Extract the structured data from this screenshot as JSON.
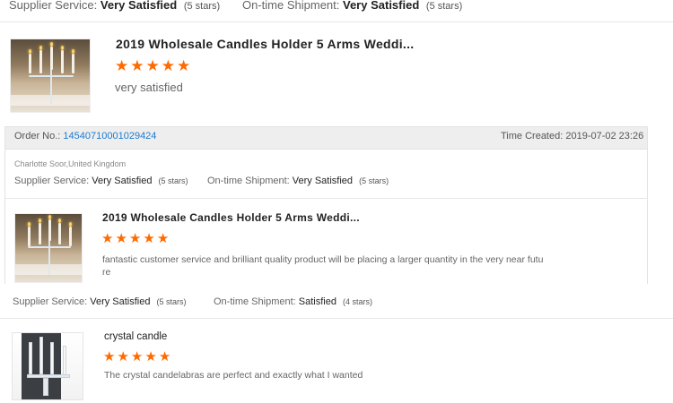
{
  "top_bar": {
    "supplier_label": "Supplier Service:",
    "supplier_value": "Very Satisfied",
    "supplier_stars": "(5 stars)",
    "shipment_label": "On-time Shipment:",
    "shipment_value": "Very Satisfied",
    "shipment_stars": "(5 stars)"
  },
  "review1": {
    "title": "2019 Wholesale Candles Holder 5 Arms Weddi...",
    "rating": 5,
    "comment": "very satisfied"
  },
  "order": {
    "label": "Order No.:",
    "number": "14540710001029424",
    "time_label": "Time Created:",
    "time_value": "2019-07-02 23:26"
  },
  "review2": {
    "buyer": "Charlotte Soor,United Kingdom",
    "supplier_label": "Supplier Service:",
    "supplier_value": "Very Satisfied",
    "supplier_stars": "(5 stars)",
    "shipment_label": "On-time Shipment:",
    "shipment_value": "Very Satisfied",
    "shipment_stars": "(5 stars)",
    "title": "2019 Wholesale Candles Holder 5 Arms Weddi...",
    "rating": 5,
    "comment_line1": "fantastic customer service and brilliant quality product will be placing a larger quantity in the very near futu",
    "comment_line2": "re"
  },
  "review3": {
    "supplier_label": "Supplier Service:",
    "supplier_value": "Very Satisfied",
    "supplier_stars": "(5 stars)",
    "shipment_label": "On-time Shipment:",
    "shipment_value": "Satisfied",
    "shipment_stars": "(4 stars)",
    "title": "crystal candle",
    "rating": 5,
    "comment": "The crystal candelabras are perfect and exactly what I wanted"
  },
  "icons": {
    "star": "★",
    "accent_color": "#ff6a00",
    "link_color": "#1d7bd0"
  }
}
